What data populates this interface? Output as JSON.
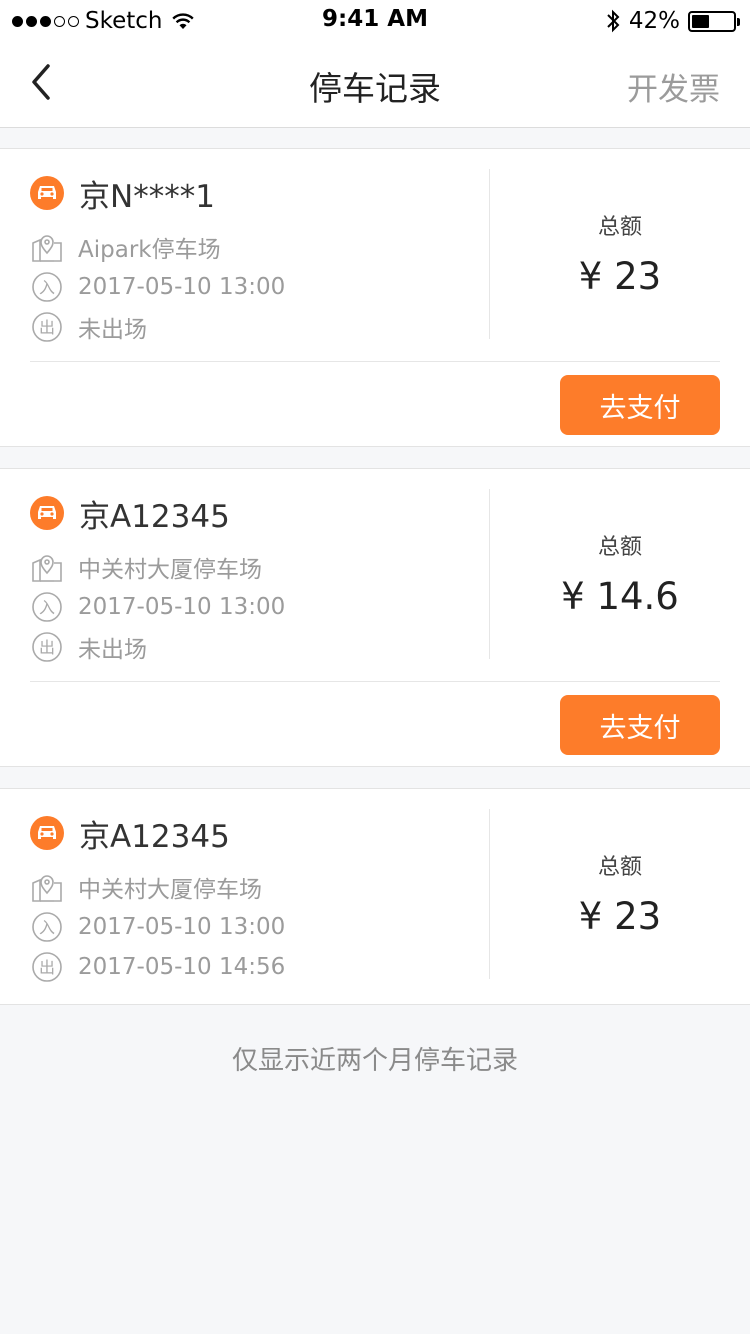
{
  "status_bar": {
    "carrier": "Sketch",
    "time": "9:41 AM",
    "battery_percent": "42%",
    "battery_level": 0.42
  },
  "nav": {
    "title": "停车记录",
    "right_action": "开发票",
    "back_icon": "chevron-left-icon"
  },
  "records": [
    {
      "plate": "京N****1",
      "lot": "Aipark停车场",
      "entry_time": "2017-05-10 13:00",
      "exit_time": "未出场",
      "total_label": "总额",
      "amount": "¥ 23",
      "pay_label": "去支付"
    },
    {
      "plate": "京A12345",
      "lot": "中关村大厦停车场",
      "entry_time": "2017-05-10 13:00",
      "exit_time": "未出场",
      "total_label": "总额",
      "amount": "¥ 14.6",
      "pay_label": "去支付"
    },
    {
      "plate": "京A12345",
      "lot": "中关村大厦停车场",
      "entry_time": "2017-05-10 13:00",
      "exit_time": "2017-05-10 14:56",
      "total_label": "总额",
      "amount": "¥ 23"
    }
  ],
  "icons": {
    "in_glyph": "入",
    "out_glyph": "出"
  },
  "footer_note": "仅显示近两个月停车记录",
  "colors": {
    "accent": "#fd7c2a",
    "background": "#f6f7f9",
    "secondary_text": "#9b9b9b"
  }
}
